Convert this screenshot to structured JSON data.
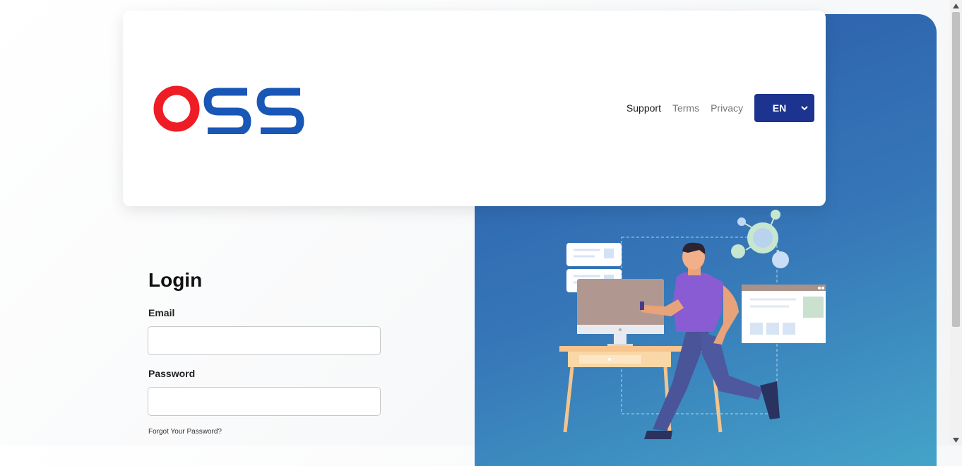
{
  "brand": {
    "logo_text": "OSS",
    "colors": {
      "red": "#ee1c24",
      "blue": "#1957b6",
      "nav_button": "#1c3490"
    }
  },
  "nav": {
    "support": "Support",
    "terms": "Terms",
    "privacy": "Privacy",
    "language": "EN"
  },
  "login": {
    "title": "Login",
    "email_label": "Email",
    "email_value": "",
    "password_label": "Password",
    "password_value": "",
    "forgot_link": "Forgot Your Password?"
  },
  "illustration": {
    "icons": [
      "chat-bubble-icon",
      "monitor-icon",
      "browser-window-icon",
      "network-nodes-icon"
    ]
  }
}
